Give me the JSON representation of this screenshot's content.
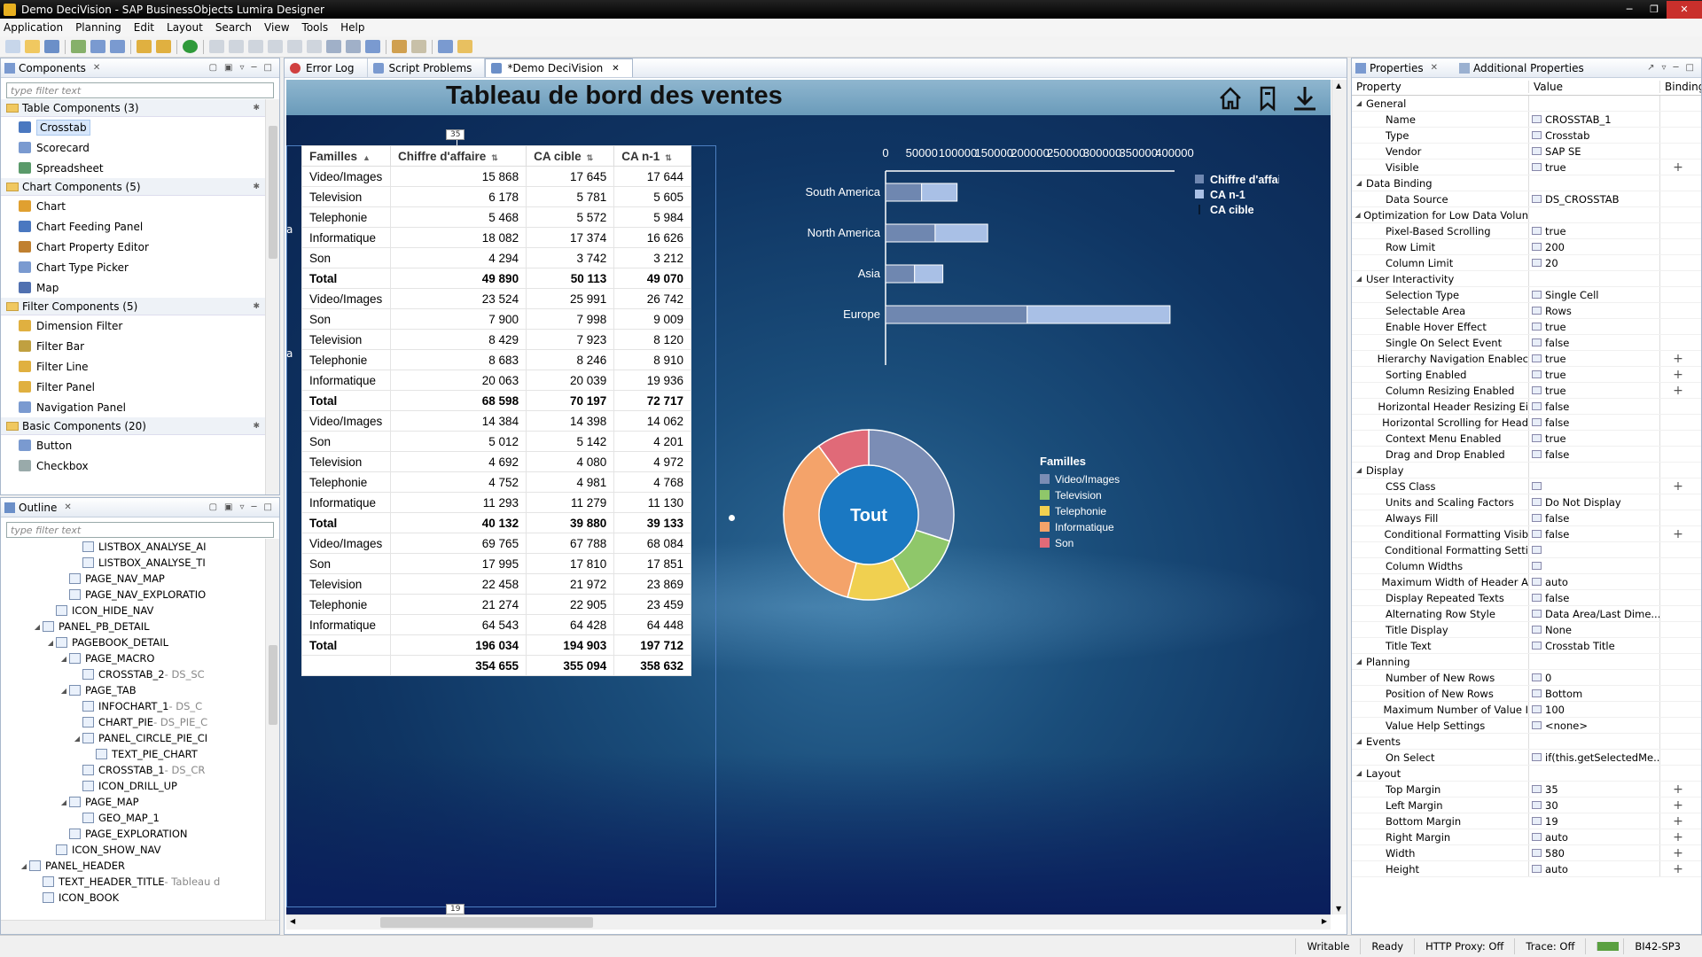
{
  "window": {
    "title": "Demo DeciVision - SAP BusinessObjects Lumira Designer"
  },
  "menu": [
    "Application",
    "Planning",
    "Edit",
    "Layout",
    "Search",
    "View",
    "Tools",
    "Help"
  ],
  "components": {
    "title": "Components",
    "filter_placeholder": "type filter text",
    "categories": [
      {
        "label": "Table Components (3)",
        "items": [
          "Crosstab",
          "Scorecard",
          "Spreadsheet"
        ]
      },
      {
        "label": "Chart Components (5)",
        "items": [
          "Chart",
          "Chart Feeding Panel",
          "Chart Property Editor",
          "Chart Type Picker",
          "Map"
        ]
      },
      {
        "label": "Filter Components (5)",
        "items": [
          "Dimension Filter",
          "Filter Bar",
          "Filter Line",
          "Filter Panel",
          "Navigation Panel"
        ]
      },
      {
        "label": "Basic Components (20)",
        "items": [
          "Button",
          "Checkbox"
        ]
      }
    ]
  },
  "outline": {
    "title": "Outline",
    "filter_placeholder": "type filter text",
    "items": [
      {
        "indent": 8,
        "tw": "",
        "label": "LISTBOX_ANALYSE_AI",
        "suffix": ""
      },
      {
        "indent": 8,
        "tw": "",
        "label": "LISTBOX_ANALYSE_TI",
        "suffix": ""
      },
      {
        "indent": 7,
        "tw": "",
        "label": "PAGE_NAV_MAP",
        "suffix": ""
      },
      {
        "indent": 7,
        "tw": "",
        "label": "PAGE_NAV_EXPLORATIO",
        "suffix": ""
      },
      {
        "indent": 6,
        "tw": "",
        "label": "ICON_HIDE_NAV",
        "suffix": ""
      },
      {
        "indent": 5,
        "tw": "▲",
        "label": "PANEL_PB_DETAIL",
        "suffix": ""
      },
      {
        "indent": 6,
        "tw": "▲",
        "label": "PAGEBOOK_DETAIL",
        "suffix": ""
      },
      {
        "indent": 7,
        "tw": "▲",
        "label": "PAGE_MACRO",
        "suffix": ""
      },
      {
        "indent": 8,
        "tw": "",
        "label": "CROSSTAB_2",
        "suffix": " - DS_SC"
      },
      {
        "indent": 7,
        "tw": "▲",
        "label": "PAGE_TAB",
        "suffix": ""
      },
      {
        "indent": 8,
        "tw": "",
        "label": "INFOCHART_1",
        "suffix": " - DS_C"
      },
      {
        "indent": 8,
        "tw": "",
        "label": "CHART_PIE",
        "suffix": " - DS_PIE_C"
      },
      {
        "indent": 8,
        "tw": "▲",
        "label": "PANEL_CIRCLE_PIE_CI",
        "suffix": ""
      },
      {
        "indent": 9,
        "tw": "",
        "label": "TEXT_PIE_CHART",
        "suffix": ""
      },
      {
        "indent": 8,
        "tw": "",
        "label": "CROSSTAB_1",
        "suffix": " - DS_CR"
      },
      {
        "indent": 8,
        "tw": "",
        "label": "ICON_DRILL_UP",
        "suffix": ""
      },
      {
        "indent": 7,
        "tw": "▲",
        "label": "PAGE_MAP",
        "suffix": ""
      },
      {
        "indent": 8,
        "tw": "",
        "label": "GEO_MAP_1",
        "suffix": ""
      },
      {
        "indent": 7,
        "tw": "",
        "label": "PAGE_EXPLORATION",
        "suffix": ""
      },
      {
        "indent": 6,
        "tw": "",
        "label": "ICON_SHOW_NAV",
        "suffix": ""
      },
      {
        "indent": 4,
        "tw": "▲",
        "label": "PANEL_HEADER",
        "suffix": ""
      },
      {
        "indent": 5,
        "tw": "",
        "label": "TEXT_HEADER_TITLE",
        "suffix": " - Tableau d"
      },
      {
        "indent": 5,
        "tw": "",
        "label": "ICON_BOOK",
        "suffix": ""
      }
    ]
  },
  "editor": {
    "tabs": [
      "Error Log",
      "Script Problems",
      "*Demo DeciVision"
    ],
    "dashboard_title": "Tableau de bord des ventes",
    "top_marker": "35",
    "bottom_marker": "19",
    "edge_letter": "a"
  },
  "crosstab": {
    "headers": [
      "Familles",
      "Chiffre d'affaire",
      "CA cible",
      "CA n-1"
    ],
    "rows": [
      {
        "label": "Video/Images",
        "values": [
          "15 868",
          "17 645",
          "17 644"
        ],
        "type": "row"
      },
      {
        "label": "Television",
        "values": [
          "6 178",
          "5 781",
          "5 605"
        ],
        "type": "row"
      },
      {
        "label": "Telephonie",
        "values": [
          "5 468",
          "5 572",
          "5 984"
        ],
        "type": "row"
      },
      {
        "label": "Informatique",
        "values": [
          "18 082",
          "17 374",
          "16 626"
        ],
        "type": "row"
      },
      {
        "label": "Son",
        "values": [
          "4 294",
          "3 742",
          "3 212"
        ],
        "type": "row"
      },
      {
        "label": "Total",
        "values": [
          "49 890",
          "50 113",
          "49 070"
        ],
        "type": "total"
      },
      {
        "label": "Video/Images",
        "values": [
          "23 524",
          "25 991",
          "26 742"
        ],
        "type": "row"
      },
      {
        "label": "Son",
        "values": [
          "7 900",
          "7 998",
          "9 009"
        ],
        "type": "row"
      },
      {
        "label": "Television",
        "values": [
          "8 429",
          "7 923",
          "8 120"
        ],
        "type": "row"
      },
      {
        "label": "Telephonie",
        "values": [
          "8 683",
          "8 246",
          "8 910"
        ],
        "type": "row"
      },
      {
        "label": "Informatique",
        "values": [
          "20 063",
          "20 039",
          "19 936"
        ],
        "type": "row"
      },
      {
        "label": "Total",
        "values": [
          "68 598",
          "70 197",
          "72 717"
        ],
        "type": "total"
      },
      {
        "label": "Video/Images",
        "values": [
          "14 384",
          "14 398",
          "14 062"
        ],
        "type": "row"
      },
      {
        "label": "Son",
        "values": [
          "5 012",
          "5 142",
          "4 201"
        ],
        "type": "row"
      },
      {
        "label": "Television",
        "values": [
          "4 692",
          "4 080",
          "4 972"
        ],
        "type": "row"
      },
      {
        "label": "Telephonie",
        "values": [
          "4 752",
          "4 981",
          "4 768"
        ],
        "type": "row"
      },
      {
        "label": "Informatique",
        "values": [
          "11 293",
          "11 279",
          "11 130"
        ],
        "type": "row"
      },
      {
        "label": "Total",
        "values": [
          "40 132",
          "39 880",
          "39 133"
        ],
        "type": "total"
      },
      {
        "label": "Video/Images",
        "values": [
          "69 765",
          "67 788",
          "68 084"
        ],
        "type": "row"
      },
      {
        "label": "Son",
        "values": [
          "17 995",
          "17 810",
          "17 851"
        ],
        "type": "row"
      },
      {
        "label": "Television",
        "values": [
          "22 458",
          "21 972",
          "23 869"
        ],
        "type": "row"
      },
      {
        "label": "Telephonie",
        "values": [
          "21 274",
          "22 905",
          "23 459"
        ],
        "type": "row"
      },
      {
        "label": "Informatique",
        "values": [
          "64 543",
          "64 428",
          "64 448"
        ],
        "type": "row"
      },
      {
        "label": "Total",
        "values": [
          "196 034",
          "194 903",
          "197 712"
        ],
        "type": "total"
      },
      {
        "label": "",
        "values": [
          "354 655",
          "355 094",
          "358 632"
        ],
        "type": "grand"
      }
    ]
  },
  "chart_data": [
    {
      "type": "bar",
      "orientation": "horizontal",
      "stacked": true,
      "categories": [
        "South America",
        "North America",
        "Asia",
        "Europe"
      ],
      "series": [
        {
          "name": "Chiffre d'affaire",
          "color": "#6f87b0",
          "values": [
            49890,
            68598,
            40132,
            196034
          ]
        },
        {
          "name": "CA n-1",
          "color": "#a9c0e6",
          "values": [
            49070,
            72717,
            39133,
            197712
          ]
        },
        {
          "name": "CA cible",
          "color": "#ffffff",
          "values": []
        }
      ],
      "xlim": [
        0,
        400000
      ],
      "xticks": [
        "0",
        "50000",
        "100000",
        "150000",
        "200000",
        "250000",
        "300000",
        "350000",
        "400000"
      ],
      "legend": "right"
    },
    {
      "type": "pie",
      "donut": true,
      "center_label": "Tout",
      "legend_title": "Familles",
      "slices": [
        {
          "name": "Video/Images",
          "value": 30,
          "color": "#7b8db5"
        },
        {
          "name": "Television",
          "value": 12,
          "color": "#8fc76a"
        },
        {
          "name": "Telephonie",
          "value": 12,
          "color": "#f0d050"
        },
        {
          "name": "Informatique",
          "value": 36,
          "color": "#f4a36a"
        },
        {
          "name": "Son",
          "value": 10,
          "color": "#e06a78"
        }
      ]
    }
  ],
  "properties": {
    "tabs": [
      "Properties",
      "Additional Properties"
    ],
    "columns": [
      "Property",
      "Value",
      "Binding"
    ],
    "rows": [
      {
        "g": true,
        "name": "General"
      },
      {
        "name": "Name",
        "value": "CROSSTAB_1",
        "b": ""
      },
      {
        "name": "Type",
        "value": "Crosstab",
        "b": ""
      },
      {
        "name": "Vendor",
        "value": "SAP SE",
        "b": ""
      },
      {
        "name": "Visible",
        "value": "true",
        "b": "+"
      },
      {
        "g": true,
        "name": "Data Binding"
      },
      {
        "name": "Data Source",
        "value": "DS_CROSSTAB",
        "b": ""
      },
      {
        "g": true,
        "name": "Optimization for Low Data Volun"
      },
      {
        "name": "Pixel-Based Scrolling",
        "value": "true",
        "b": ""
      },
      {
        "name": "Row Limit",
        "value": "200",
        "b": ""
      },
      {
        "name": "Column Limit",
        "value": "20",
        "b": ""
      },
      {
        "g": true,
        "name": "User Interactivity"
      },
      {
        "name": "Selection Type",
        "value": "Single Cell",
        "b": ""
      },
      {
        "name": "Selectable Area",
        "value": "Rows",
        "b": ""
      },
      {
        "name": "Enable Hover Effect",
        "value": "true",
        "b": ""
      },
      {
        "name": "Single On Select Event",
        "value": "false",
        "b": ""
      },
      {
        "name": "Hierarchy Navigation Enablec",
        "value": "true",
        "b": "+"
      },
      {
        "name": "Sorting Enabled",
        "value": "true",
        "b": "+"
      },
      {
        "name": "Column Resizing Enabled",
        "value": "true",
        "b": "+"
      },
      {
        "name": "Horizontal Header Resizing Ei",
        "value": "false",
        "b": ""
      },
      {
        "name": "Horizontal Scrolling for Head",
        "value": "false",
        "b": ""
      },
      {
        "name": "Context Menu Enabled",
        "value": "true",
        "b": ""
      },
      {
        "name": "Drag and Drop Enabled",
        "value": "false",
        "b": ""
      },
      {
        "g": true,
        "name": "Display"
      },
      {
        "name": "CSS Class",
        "value": "",
        "b": "+"
      },
      {
        "name": "Units and Scaling Factors",
        "value": "Do Not Display",
        "b": ""
      },
      {
        "name": "Always Fill",
        "value": "false",
        "b": ""
      },
      {
        "name": "Conditional Formatting Visib",
        "value": "false",
        "b": "+"
      },
      {
        "name": "Conditional Formatting Setti",
        "value": "",
        "b": ""
      },
      {
        "name": "Column Widths",
        "value": "",
        "b": ""
      },
      {
        "name": "Maximum Width of Header A",
        "value": "auto",
        "b": ""
      },
      {
        "name": "Display Repeated Texts",
        "value": "false",
        "b": ""
      },
      {
        "name": "Alternating Row Style",
        "value": "Data Area/Last Dime...",
        "b": ""
      },
      {
        "name": "Title Display",
        "value": "None",
        "b": ""
      },
      {
        "name": "Title Text",
        "value": "Crosstab Title",
        "b": ""
      },
      {
        "g": true,
        "name": "Planning"
      },
      {
        "name": "Number of New Rows",
        "value": "0",
        "b": ""
      },
      {
        "name": "Position of New Rows",
        "value": "Bottom",
        "b": ""
      },
      {
        "name": "Maximum Number of Value I",
        "value": "100",
        "b": ""
      },
      {
        "name": "Value Help Settings",
        "value": "<none>",
        "b": ""
      },
      {
        "g": true,
        "name": "Events"
      },
      {
        "name": "On Select",
        "value": "if(this.getSelectedMe...",
        "b": ""
      },
      {
        "g": true,
        "name": "Layout"
      },
      {
        "name": "Top Margin",
        "value": "35",
        "b": "+"
      },
      {
        "name": "Left Margin",
        "value": "30",
        "b": "+"
      },
      {
        "name": "Bottom Margin",
        "value": "19",
        "b": "+"
      },
      {
        "name": "Right Margin",
        "value": "auto",
        "b": "+"
      },
      {
        "name": "Width",
        "value": "580",
        "b": "+"
      },
      {
        "name": "Height",
        "value": "auto",
        "b": "+"
      }
    ]
  },
  "status": [
    "Writable",
    "Ready",
    "HTTP Proxy: Off",
    "Trace: Off",
    "BI42-SP3"
  ]
}
